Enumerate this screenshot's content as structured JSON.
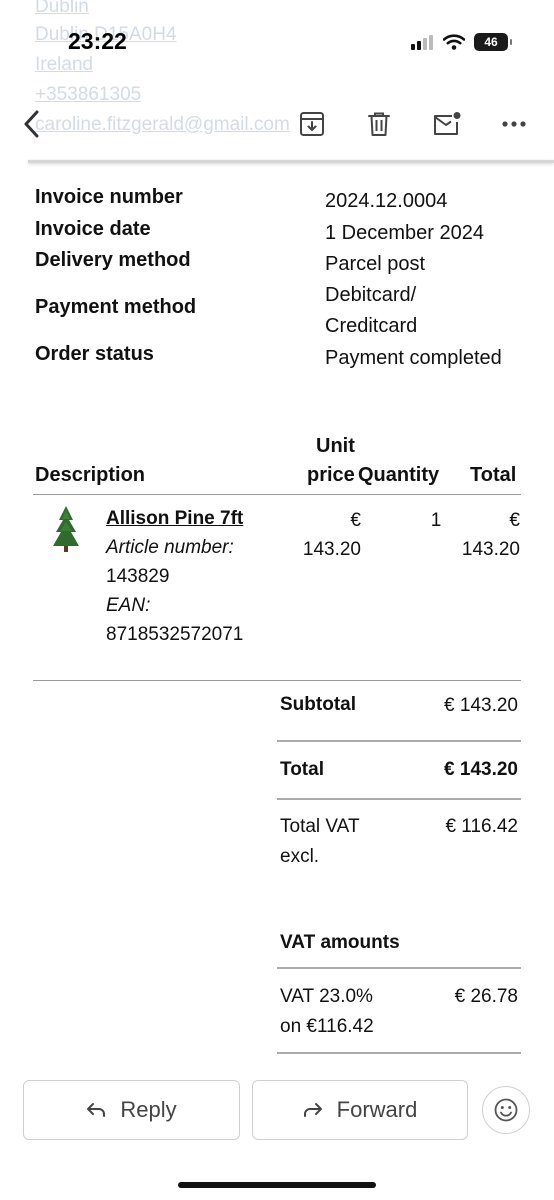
{
  "status_bar": {
    "time": "23:22",
    "battery": "46"
  },
  "background_text": [
    "Dublin",
    "Dublin D15A0H4",
    "Ireland",
    "+353861305",
    "caroline.fitzgerald@gmail.com"
  ],
  "info": [
    {
      "label": "Invoice number",
      "value": "2024.12.0004"
    },
    {
      "label": "Invoice date",
      "value": "1 December 2024"
    },
    {
      "label": "Delivery method",
      "value": "Parcel post"
    },
    {
      "label": "Payment method",
      "value_lines": [
        "Debitcard/",
        "Creditcard"
      ]
    },
    {
      "label": "Order status",
      "value": "Payment completed"
    }
  ],
  "table": {
    "headers": {
      "description": "Description",
      "unit_price_1": "Unit",
      "unit_price_2": "price",
      "quantity": "Quantity",
      "total": "Total"
    },
    "item": {
      "name": "Allison Pine 7ft",
      "article_label": "Article number:",
      "article_number": "143829",
      "ean_label": "EAN:",
      "ean": "8718532572071",
      "unit_price_currency": "€",
      "unit_price": "143.20",
      "quantity": "1",
      "total_currency": "€",
      "total": "143.20"
    }
  },
  "totals": {
    "subtotal_label": "Subtotal",
    "subtotal": "€ 143.20",
    "total_label": "Total",
    "total": "€ 143.20",
    "vat_excl_label_1": "Total VAT",
    "vat_excl_label_2": "excl.",
    "vat_excl": "€ 116.42",
    "vat_amounts_label": "VAT amounts",
    "vat_rate_label_1": "VAT 23.0%",
    "vat_rate_label_2": "on €116.42",
    "vat_amount": "€ 26.78"
  },
  "actions": {
    "reply": "Reply",
    "forward": "Forward"
  },
  "icons": [
    "back-icon",
    "archive-icon",
    "trash-icon",
    "mark-unread-icon",
    "more-icon",
    "reply-icon",
    "forward-icon",
    "emoji-icon",
    "tree-thumbnail"
  ]
}
